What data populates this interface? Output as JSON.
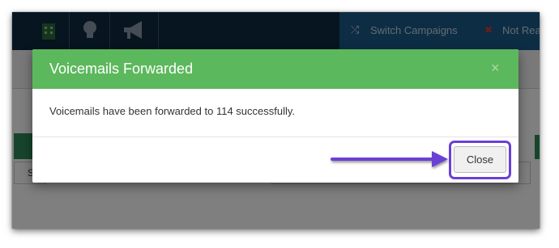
{
  "topbar": {
    "switch_campaigns_label": "Switch Campaigns",
    "status_label": "Not Rea",
    "icons": [
      "building-icon",
      "lightbulb-icon",
      "megaphone-icon",
      "shuffle-icon",
      "close-icon"
    ]
  },
  "background": {
    "box_text": "S"
  },
  "modal": {
    "title": "Voicemails Forwarded",
    "close_symbol": "×",
    "message": "Voicemails have been forwarded to 114 successfully.",
    "close_button_label": "Close"
  },
  "colors": {
    "header_green": "#5cb85c",
    "highlight_purple": "#6a3fd6",
    "topbar_navy": "#0e2a40",
    "topbar_blue": "#1a5b8a"
  }
}
